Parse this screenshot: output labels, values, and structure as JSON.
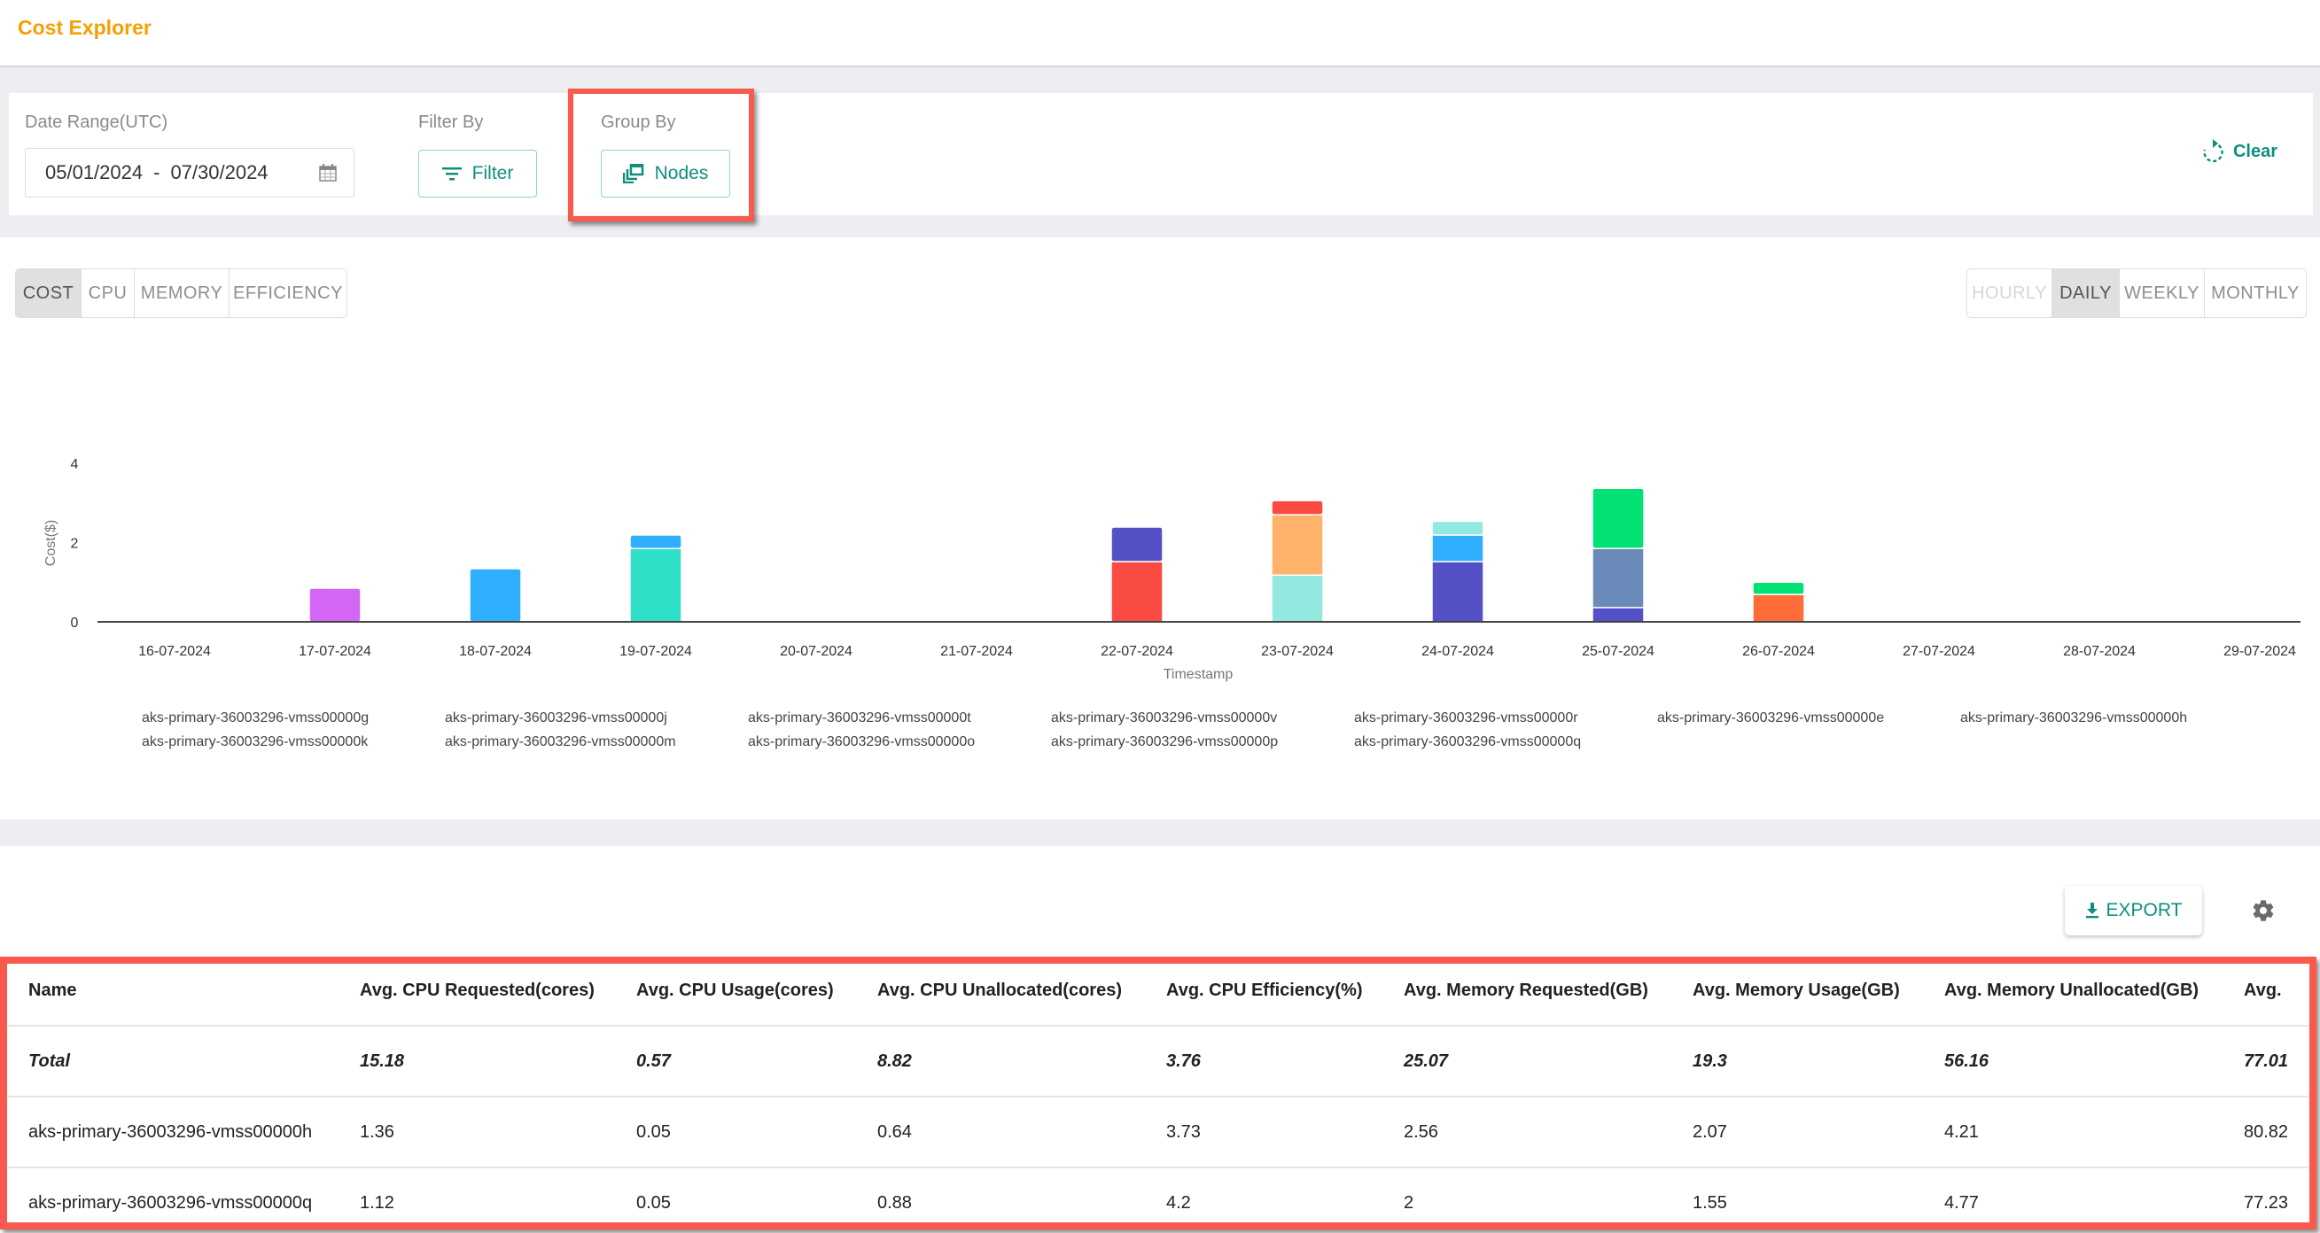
{
  "header": {
    "title": "Cost Explorer"
  },
  "filters": {
    "date_range_label": "Date Range(UTC)",
    "date_start": "05/01/2024",
    "date_separator": "-",
    "date_end": "07/30/2024",
    "filter_by_label": "Filter By",
    "filter_button": "Filter",
    "group_by_label": "Group By",
    "group_by_button": "Nodes",
    "clear_button": "Clear"
  },
  "metric_tabs": [
    {
      "label": "COST",
      "active": true
    },
    {
      "label": "CPU",
      "active": false
    },
    {
      "label": "MEMORY",
      "active": false
    },
    {
      "label": "EFFICIENCY",
      "active": false
    }
  ],
  "granularity_tabs": [
    {
      "label": "HOURLY",
      "active": false,
      "disabled": true
    },
    {
      "label": "DAILY",
      "active": true,
      "disabled": false
    },
    {
      "label": "WEEKLY",
      "active": false,
      "disabled": false
    },
    {
      "label": "MONTHLY",
      "active": false,
      "disabled": false
    }
  ],
  "colors": {
    "accent": "#0d8f80",
    "title": "#f5a000",
    "highlight": "#fa5a4e"
  },
  "chart_data": {
    "type": "bar",
    "stacked": true,
    "title": "",
    "xlabel": "Timestamp",
    "ylabel": "Cost($)",
    "ylim": [
      0,
      4
    ],
    "yticks": [
      0,
      2,
      4
    ],
    "grid": false,
    "legend_position": "bottom",
    "categories": [
      "16-07-2024",
      "17-07-2024",
      "18-07-2024",
      "19-07-2024",
      "20-07-2024",
      "21-07-2024",
      "22-07-2024",
      "23-07-2024",
      "24-07-2024",
      "25-07-2024",
      "26-07-2024",
      "27-07-2024",
      "28-07-2024",
      "29-07-2024"
    ],
    "stacks": [
      [],
      [
        {
          "color": "#d466f5",
          "value": 0.85
        }
      ],
      [
        {
          "color": "#2eaefc",
          "value": 1.34
        }
      ],
      [
        {
          "color": "#2fe0c9",
          "value": 1.85
        },
        {
          "color": "#2eaefc",
          "value": 0.34
        }
      ],
      [],
      [],
      [
        {
          "color": "#fa4b43",
          "value": 1.52
        },
        {
          "color": "#5450c5",
          "value": 0.87
        }
      ],
      [
        {
          "color": "#93e9df",
          "value": 1.18
        },
        {
          "color": "#feb26a",
          "value": 1.52
        },
        {
          "color": "#fa4b43",
          "value": 0.36
        }
      ],
      [
        {
          "color": "#5450c5",
          "value": 1.52
        },
        {
          "color": "#2eaefc",
          "value": 0.67
        },
        {
          "color": "#93e9df",
          "value": 0.35
        }
      ],
      [
        {
          "color": "#5450c5",
          "value": 0.36
        },
        {
          "color": "#6a8ab9",
          "value": 1.49
        },
        {
          "color": "#02e272",
          "value": 1.52
        }
      ],
      [
        {
          "color": "#fe6c37",
          "value": 0.69
        },
        {
          "color": "#02e272",
          "value": 0.31
        }
      ],
      [],
      [],
      []
    ],
    "legend": [
      "aks-primary-36003296-vmss00000g",
      "aks-primary-36003296-vmss00000k",
      "aks-primary-36003296-vmss00000j",
      "aks-primary-36003296-vmss00000m",
      "aks-primary-36003296-vmss00000t",
      "aks-primary-36003296-vmss00000o",
      "aks-primary-36003296-vmss00000v",
      "aks-primary-36003296-vmss00000p",
      "aks-primary-36003296-vmss00000r",
      "aks-primary-36003296-vmss00000q",
      "aks-primary-36003296-vmss00000e",
      "aks-primary-36003296-vmss00000h"
    ]
  },
  "table": {
    "export_button": "EXPORT",
    "columns": [
      "Name",
      "Avg. CPU Requested(cores)",
      "Avg. CPU Usage(cores)",
      "Avg. CPU Unallocated(cores)",
      "Avg. CPU Efficiency(%)",
      "Avg. Memory Requested(GB)",
      "Avg. Memory Usage(GB)",
      "Avg. Memory Unallocated(GB)",
      "Avg."
    ],
    "total_row": [
      "Total",
      "15.18",
      "0.57",
      "8.82",
      "3.76",
      "25.07",
      "19.3",
      "56.16",
      "77.01"
    ],
    "rows": [
      [
        "aks-primary-36003296-vmss00000h",
        "1.36",
        "0.05",
        "0.64",
        "3.73",
        "2.56",
        "2.07",
        "4.21",
        "80.82"
      ],
      [
        "aks-primary-36003296-vmss00000q",
        "1.12",
        "0.05",
        "0.88",
        "4.2",
        "2",
        "1.55",
        "4.77",
        "77.23"
      ]
    ]
  }
}
